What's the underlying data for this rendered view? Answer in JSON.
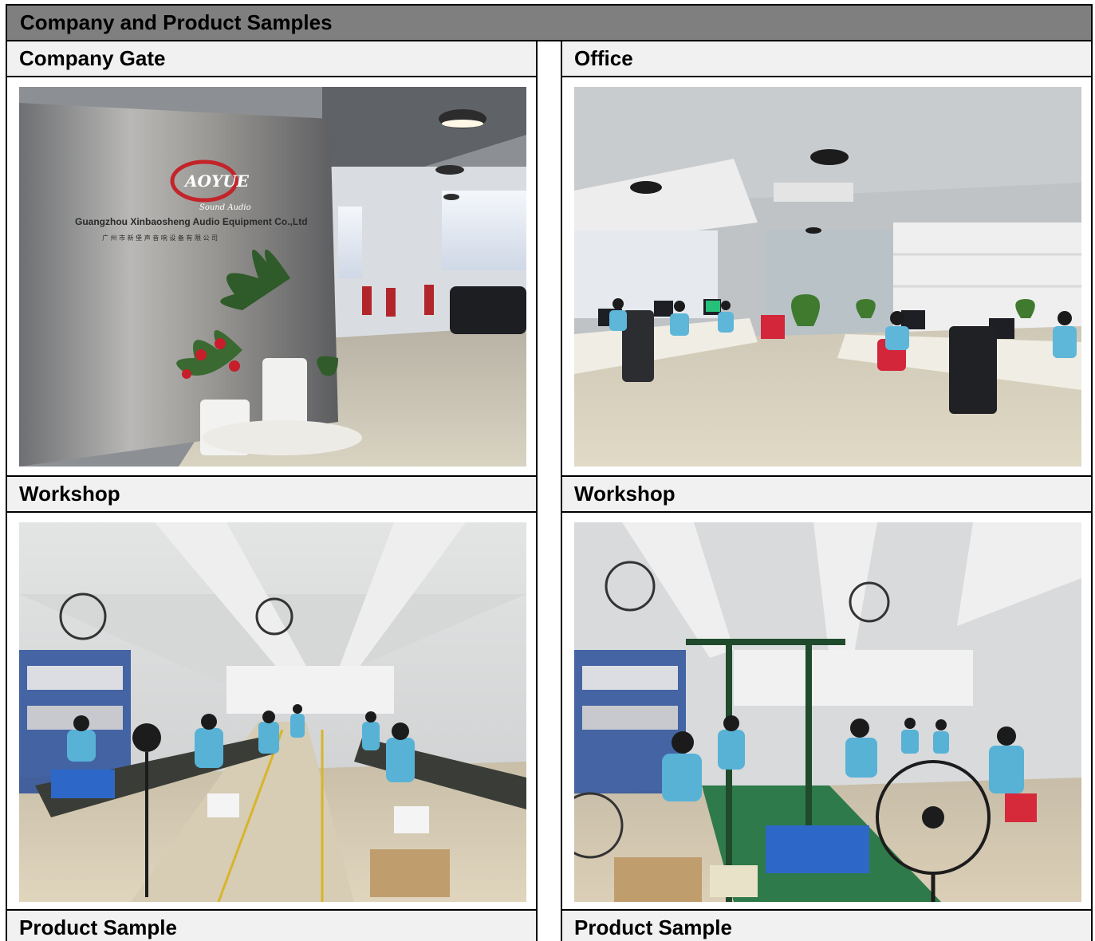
{
  "header": {
    "title": "Company and Product Samples"
  },
  "left": {
    "cells": [
      {
        "label": "Company Gate"
      },
      {
        "label": "Workshop"
      },
      {
        "label": "Product Sample"
      }
    ]
  },
  "right": {
    "cells": [
      {
        "label": "Office"
      },
      {
        "label": "Workshop"
      },
      {
        "label": "Product Sample"
      }
    ]
  },
  "gate_sign": {
    "logo": "AOYUE",
    "subtitle": "Sound Audio",
    "company_en": "Guangzhou Xinbaosheng Audio Equipment Co.,Ltd",
    "company_zh": "广 州 市 新 堡 声 音 响 设 备 有 限 公 司"
  }
}
